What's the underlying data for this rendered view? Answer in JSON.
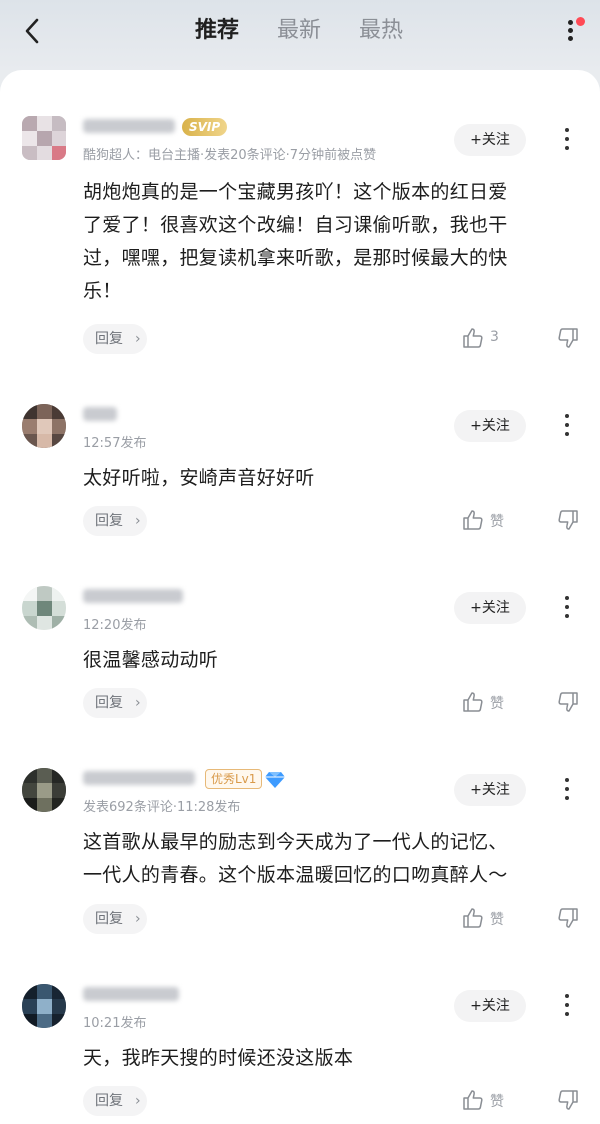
{
  "header": {
    "tabs": [
      {
        "label": "推荐",
        "active": true
      },
      {
        "label": "最新",
        "active": false
      },
      {
        "label": "最热",
        "active": false
      }
    ],
    "icons": [
      "back-arrow-icon",
      "more-vertical-icon",
      "notification-dot"
    ]
  },
  "comments": [
    {
      "badge": "SVIP",
      "meta": "酷狗超人：电台主播·发表20条评论·7分钟前被点赞",
      "follow_label": "+关注",
      "text_lines": [
        "胡炮炮真的是一个宝藏男孩吖！这个版本的红日爱",
        "了爱了！很喜欢这个改编！自习课偷听歌，我也干",
        "过，嘿嘿，把复读机拿来听歌，是那时候最大的快",
        "乐！"
      ],
      "reply_label": "回复",
      "like_label": "3"
    },
    {
      "badge": "",
      "meta": "12:57发布",
      "follow_label": "+关注",
      "text_lines": [
        "太好听啦，安崎声音好好听"
      ],
      "reply_label": "回复",
      "like_label": "赞"
    },
    {
      "badge": "",
      "meta": "12:20发布",
      "follow_label": "+关注",
      "text_lines": [
        "很温馨感动动听"
      ],
      "reply_label": "回复",
      "like_label": "赞"
    },
    {
      "badge": "优秀Lv1",
      "meta": "发表692条评论·11:28发布",
      "follow_label": "+关注",
      "text_lines": [
        "这首歌从最早的励志到今天成为了一代人的记忆、",
        "一代人的青春。这个版本温暖回忆的口吻真醉人～"
      ],
      "reply_label": "回复",
      "like_label": "赞"
    },
    {
      "badge": "",
      "meta": "10:21发布",
      "follow_label": "+关注",
      "text_lines": [
        "天，我昨天搜的时候还没这版本"
      ],
      "reply_label": "回复",
      "like_label": "赞"
    }
  ],
  "colors": {
    "svip_gold": "#d9b24a",
    "level_badge_orange": "#d99a4a",
    "notification_red": "#ff4a55",
    "diamond_blue": "#3d9bff"
  }
}
